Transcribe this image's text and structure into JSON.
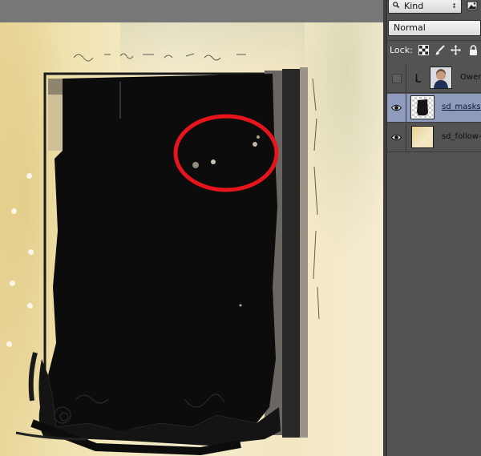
{
  "layers_panel": {
    "filter": {
      "label": "Kind",
      "icon": "search-icon",
      "image_filter_icon": "image-filter-icon"
    },
    "blend_mode": "Normal",
    "lock": {
      "label": "Lock:",
      "icons": [
        "lock-transparent-pixels-icon",
        "lock-image-pixels-icon",
        "lock-position-icon",
        "lock-all-icon"
      ]
    },
    "layers": [
      {
        "name": "Owen",
        "visible": false,
        "clipped": true,
        "selected": false
      },
      {
        "name": "sd_masks",
        "visible": true,
        "clipped": false,
        "selected": true
      },
      {
        "name": "sd_follow-",
        "visible": true,
        "clipped": false,
        "selected": false
      }
    ]
  },
  "canvas": {
    "annotation": "red-circle-highlight",
    "colors": {
      "annotation_red": "#e8141b",
      "mask_black": "#0c0c0c",
      "paper": "#f2e6c0",
      "selection": "#8f9bbd"
    }
  }
}
